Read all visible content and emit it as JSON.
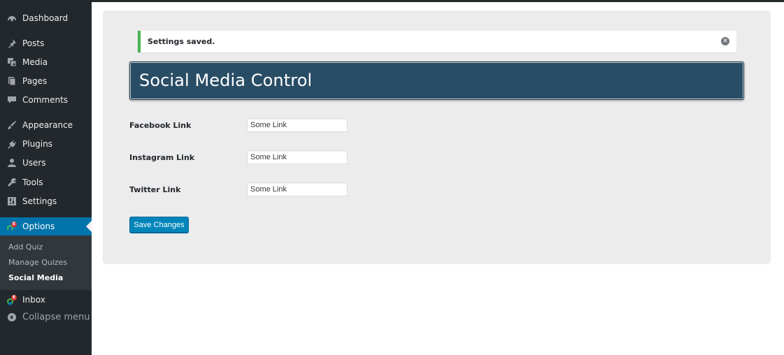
{
  "sidebar": {
    "items": [
      {
        "label": "Dashboard",
        "icon": "dashboard-icon"
      },
      {
        "label": "Posts",
        "icon": "pin-icon"
      },
      {
        "label": "Media",
        "icon": "media-icon"
      },
      {
        "label": "Pages",
        "icon": "pages-icon"
      },
      {
        "label": "Comments",
        "icon": "comment-icon"
      },
      {
        "label": "Appearance",
        "icon": "brush-icon"
      },
      {
        "label": "Plugins",
        "icon": "plug-icon"
      },
      {
        "label": "Users",
        "icon": "user-icon"
      },
      {
        "label": "Tools",
        "icon": "wrench-icon"
      },
      {
        "label": "Settings",
        "icon": "settings-icon"
      },
      {
        "label": "Options",
        "icon": "plugin-logo-icon",
        "active": true
      },
      {
        "label": "Inbox",
        "icon": "plugin-logo-icon"
      }
    ],
    "submenu": [
      {
        "label": "Add Quiz"
      },
      {
        "label": "Manage Quizes"
      },
      {
        "label": "Social Media",
        "current": true
      }
    ],
    "collapse_label": "Collapse menu"
  },
  "notice": {
    "message": "Settings saved.",
    "color": "#46b450"
  },
  "page": {
    "title": "Social Media Control"
  },
  "form": {
    "fields": [
      {
        "label": "Facebook Link",
        "value": "Some Link"
      },
      {
        "label": "Instagram Link",
        "value": "Some Link"
      },
      {
        "label": "Twitter Link",
        "value": "Some Link"
      }
    ],
    "submit_label": "Save Changes"
  },
  "colors": {
    "sidebar_bg": "#23282d",
    "active_bg": "#0073aa",
    "header_bg": "#2a4d66",
    "button_bg": "#0085ba"
  }
}
